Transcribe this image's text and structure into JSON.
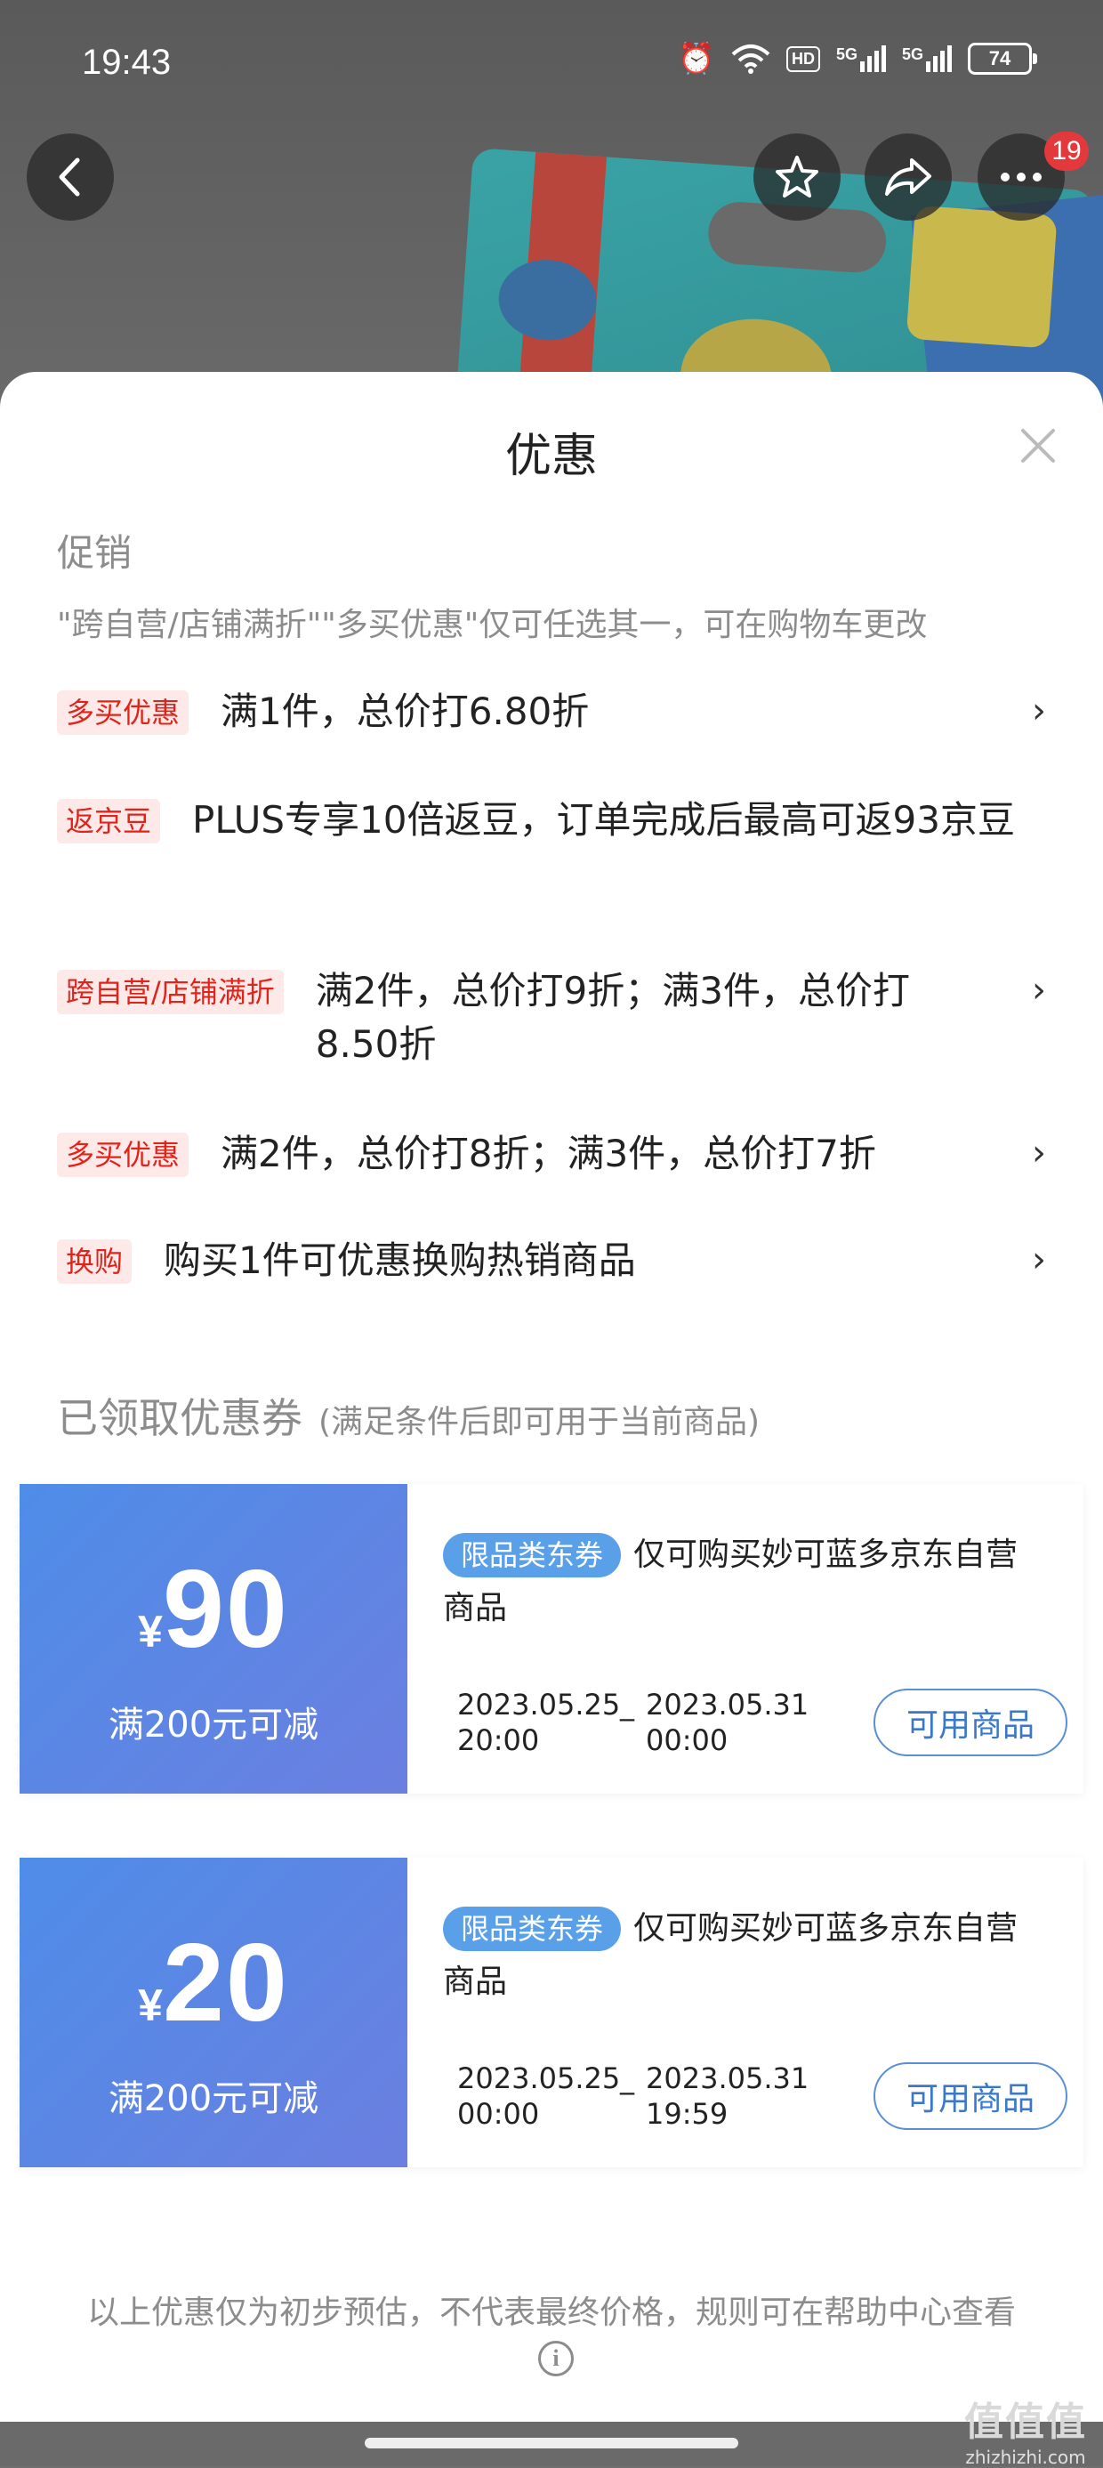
{
  "status_bar": {
    "time": "19:43",
    "hd_label": "HD",
    "net1": "5G",
    "net2": "5G",
    "battery": "74"
  },
  "top_bar": {
    "notification_count": "19",
    "icons": [
      "back-icon",
      "star-icon",
      "share-icon",
      "more-icon"
    ]
  },
  "sheet": {
    "title": "优惠",
    "promo_section_title": "促销",
    "promo_note": "\"跨自营/店铺满折\"\"多买优惠\"仅可任选其一，可在购物车更改",
    "promotions": [
      {
        "tag": "多买优惠",
        "text": "满1件，总价打6.80折",
        "has_arrow": true
      },
      {
        "tag": "返京豆",
        "text": "PLUS专享10倍返豆，订单完成后最高可返93京豆",
        "has_arrow": false
      },
      {
        "tag": "跨自营/店铺满折",
        "text": "满2件，总价打9折；满3件，总价打8.50折",
        "has_arrow": true
      },
      {
        "tag": "多买优惠",
        "text": "满2件，总价打8折；满3件，总价打7折",
        "has_arrow": true
      },
      {
        "tag": "换购",
        "text": "购买1件可优惠换购热销商品",
        "has_arrow": true
      }
    ],
    "chevron": "›",
    "coupon_section_title": "已领取优惠券",
    "coupon_section_subtitle": "(满足条件后即可用于当前商品)",
    "coupons": [
      {
        "currency": "¥",
        "amount": "90",
        "condition": "满200元可减",
        "tag": "限品类东券",
        "description": "仅可购买妙可蓝多京东自营商品",
        "start_date": "2023.05.25",
        "start_time": "20:00",
        "separator": "_",
        "end_date": "2023.05.31",
        "end_time": "00:00",
        "button": "可用商品"
      },
      {
        "currency": "¥",
        "amount": "20",
        "condition": "满200元可减",
        "tag": "限品类东券",
        "description": "仅可购买妙可蓝多京东自营商品",
        "start_date": "2023.05.25",
        "start_time": "00:00",
        "separator": "_",
        "end_date": "2023.05.31",
        "end_time": "19:59",
        "button": "可用商品"
      }
    ],
    "footer_note": "以上优惠仅为初步预估，不代表最终价格，规则可在帮助中心查看",
    "info_glyph": "i"
  },
  "watermark": {
    "logo": "值值值",
    "url": "zhizhizhi.com"
  },
  "colors": {
    "accent_red": "#e2231a",
    "coupon_blue": "#4e8de8",
    "button_blue": "#3b78c9"
  }
}
